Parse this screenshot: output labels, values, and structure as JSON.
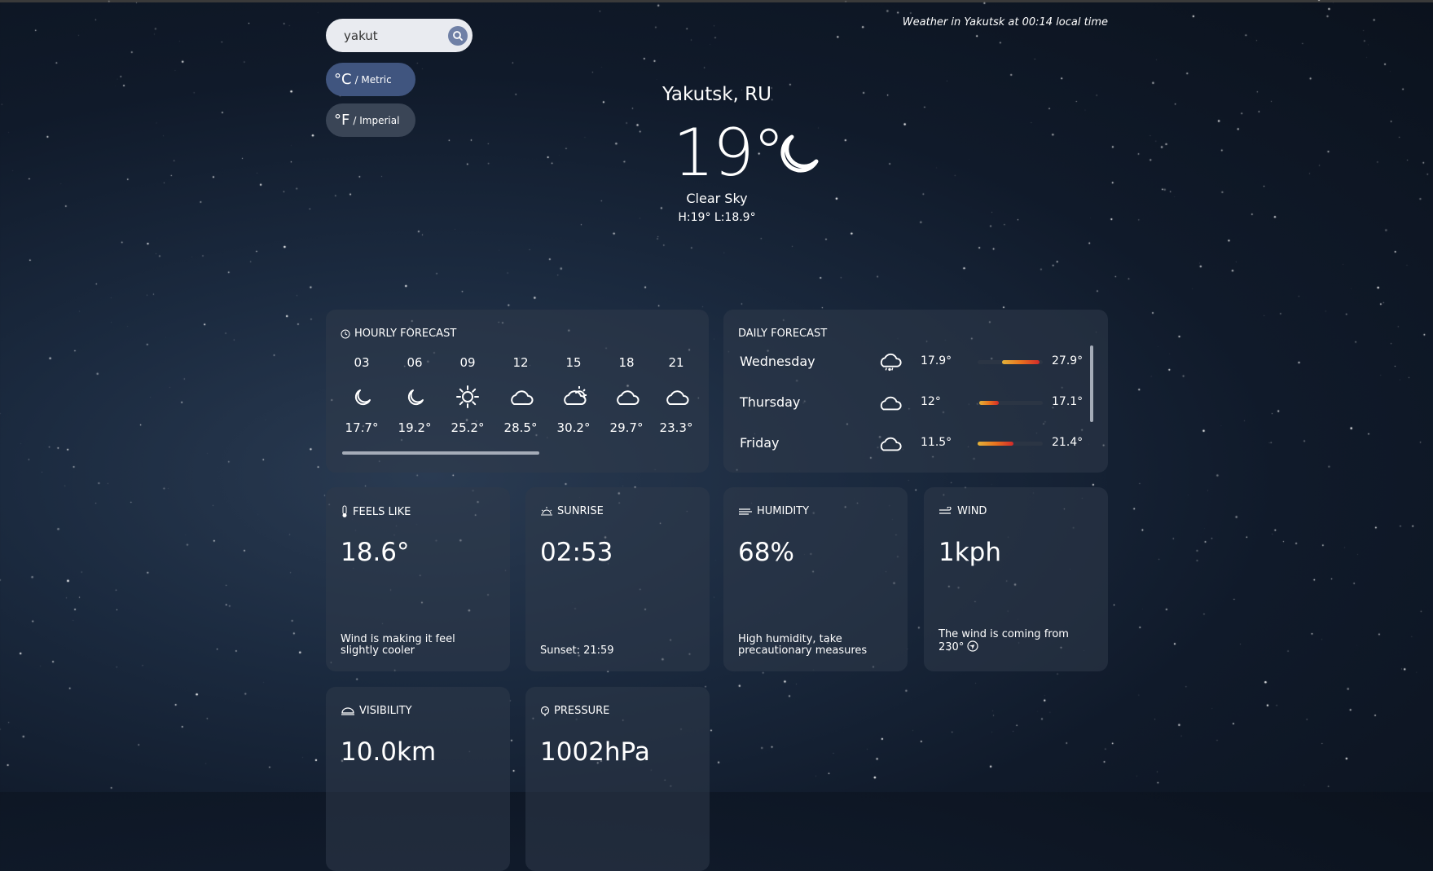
{
  "search": {
    "value": "yakut",
    "icon": "search-icon"
  },
  "units": {
    "metric": {
      "symbol": "°C",
      "label": "/ Metric"
    },
    "imperial": {
      "symbol": "°F",
      "label": "/ Imperial"
    }
  },
  "local_time": "Weather in Yakutsk at 00:14 local time",
  "current": {
    "city": "Yakutsk, RU",
    "temp": "19°",
    "condition": "Clear Sky",
    "hilo": "H:19°  L:18.9°",
    "icon": "moon-icon"
  },
  "hourly": {
    "title": "HOURLY FORECAST",
    "items": [
      {
        "hour": "03",
        "icon": "moon-icon",
        "temp": "17.7°"
      },
      {
        "hour": "06",
        "icon": "moon-icon",
        "temp": "19.2°"
      },
      {
        "hour": "09",
        "icon": "sun-icon",
        "temp": "25.2°"
      },
      {
        "hour": "12",
        "icon": "cloud-icon",
        "temp": "28.5°"
      },
      {
        "hour": "15",
        "icon": "partly-cloudy-icon",
        "temp": "30.2°"
      },
      {
        "hour": "18",
        "icon": "cloud-icon",
        "temp": "29.7°"
      },
      {
        "hour": "21",
        "icon": "cloud-icon",
        "temp": "23.3°"
      }
    ]
  },
  "daily": {
    "title": "DAILY FORECAST",
    "items": [
      {
        "day": "Wednesday",
        "icon": "rain-cloud-icon",
        "low": "17.9°",
        "high": "27.9°",
        "range": [
          0.38,
          0.95
        ]
      },
      {
        "day": "Thursday",
        "icon": "cloud-icon",
        "low": "12°",
        "high": "17.1°",
        "range": [
          0.03,
          0.32
        ]
      },
      {
        "day": "Friday",
        "icon": "cloud-icon",
        "low": "11.5°",
        "high": "21.4°",
        "range": [
          0.0,
          0.55
        ]
      }
    ]
  },
  "tiles": {
    "feels": {
      "title": "FEELS LIKE",
      "value": "18.6°",
      "desc": "Wind is making it feel slightly cooler",
      "icon": "thermometer-icon"
    },
    "sunrise": {
      "title": "SUNRISE",
      "value": "02:53",
      "desc": "Sunset: 21:59",
      "icon": "sunrise-icon"
    },
    "humidity": {
      "title": "HUMIDITY",
      "value": "68%",
      "desc": "High humidity, take precautionary measures",
      "icon": "humidity-icon"
    },
    "wind": {
      "title": "WIND",
      "value": "1kph",
      "desc": "The wind is coming from 230°",
      "icon": "wind-icon"
    },
    "visibility": {
      "title": "VISIBILITY",
      "value": "10.0km",
      "icon": "visibility-icon"
    },
    "pressure": {
      "title": "PRESSURE",
      "value": "1002hPa",
      "icon": "pressure-icon"
    }
  },
  "colors": {
    "background": "#101a2a",
    "card": "#303a4a",
    "metric_button": "#40557f",
    "imperial_button": "#3a4556",
    "bar_hot": "#d22a2a",
    "bar_warm": "#e3b23a"
  }
}
